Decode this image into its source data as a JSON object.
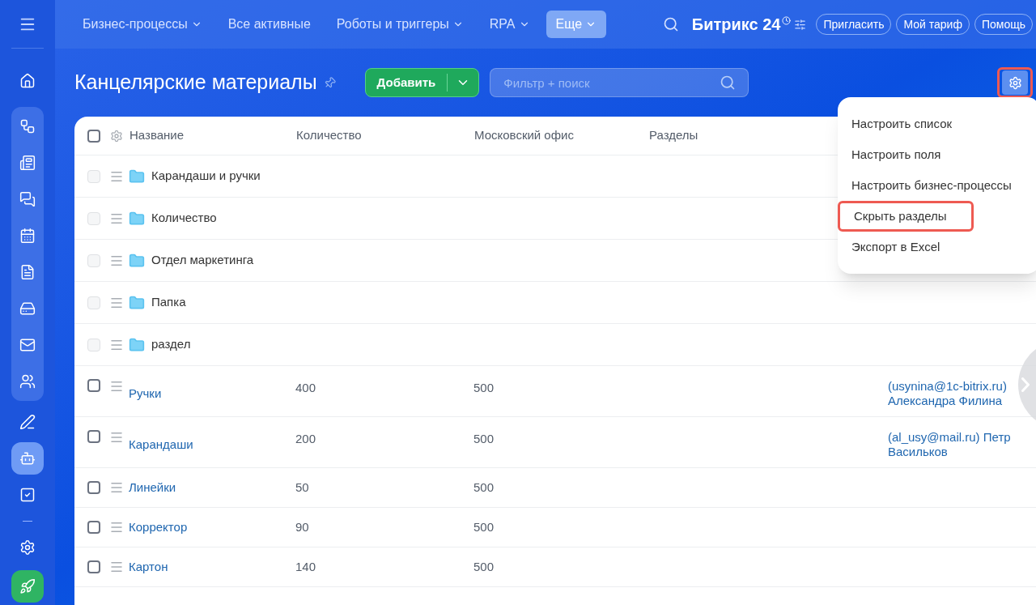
{
  "sidebar": {
    "items": [
      {
        "selected": false
      },
      {
        "selected": false
      },
      {
        "selected": false
      },
      {
        "selected": false
      },
      {
        "selected": false
      },
      {
        "selected": false
      },
      {
        "selected": false
      },
      {
        "selected": false
      },
      {
        "selected": false
      },
      {
        "selected": false
      },
      {
        "selected": true
      },
      {
        "selected": false
      },
      {
        "selected": false
      },
      {
        "selected": false
      }
    ]
  },
  "top_nav": {
    "items": [
      {
        "label": "Бизнес-процессы",
        "dropdown": true,
        "selected": false
      },
      {
        "label": "Все активные",
        "dropdown": false,
        "selected": false
      },
      {
        "label": "Роботы и триггеры",
        "dropdown": true,
        "selected": false
      },
      {
        "label": "RPA",
        "dropdown": true,
        "selected": false
      },
      {
        "label": "Еще",
        "dropdown": true,
        "selected": true
      }
    ],
    "logo": "Битрикс 24",
    "buttons": [
      "Пригласить",
      "Мой тариф",
      "Помощь"
    ]
  },
  "header": {
    "title": "Канцелярские материалы",
    "add_button": "Добавить",
    "search": {
      "placeholder": "Фильтр + поиск"
    },
    "settings_highlighted": true
  },
  "table": {
    "header_checked": false,
    "columns": [
      "Название",
      "Количество",
      "Московский офис",
      "Разделы"
    ],
    "rows": [
      {
        "kind": "folder",
        "disabled": true,
        "name": "Карандаши и ручки"
      },
      {
        "kind": "folder",
        "disabled": true,
        "name": "Количество"
      },
      {
        "kind": "folder",
        "disabled": true,
        "name": "Отдел маркетинга"
      },
      {
        "kind": "folder",
        "disabled": true,
        "name": "Папка"
      },
      {
        "kind": "folder",
        "disabled": true,
        "name": "раздел"
      },
      {
        "kind": "item",
        "disabled": false,
        "name": "Ручки",
        "quantity": "400",
        "moscow": "500",
        "user": "(usynina@1c-bitrix.ru) Александра Филина"
      },
      {
        "kind": "item",
        "disabled": false,
        "name": "Карандаши",
        "quantity": "200",
        "moscow": "500",
        "user": "(al_usy@mail.ru) Петр Васильков"
      },
      {
        "kind": "item",
        "disabled": false,
        "name": "Линейки",
        "quantity": "50",
        "moscow": "500"
      },
      {
        "kind": "item",
        "disabled": false,
        "name": "Корректор",
        "quantity": "90",
        "moscow": "500"
      },
      {
        "kind": "item",
        "disabled": false,
        "name": "Картон",
        "quantity": "140",
        "moscow": "500"
      }
    ]
  },
  "settings_menu": {
    "items": [
      {
        "label": "Настроить список",
        "highlighted": false
      },
      {
        "label": "Настроить поля",
        "highlighted": false
      },
      {
        "label": "Настроить бизнес-процессы",
        "highlighted": false
      },
      {
        "label": "Скрыть разделы",
        "highlighted": true
      },
      {
        "label": "Экспорт в Excel",
        "highlighted": false
      }
    ]
  }
}
